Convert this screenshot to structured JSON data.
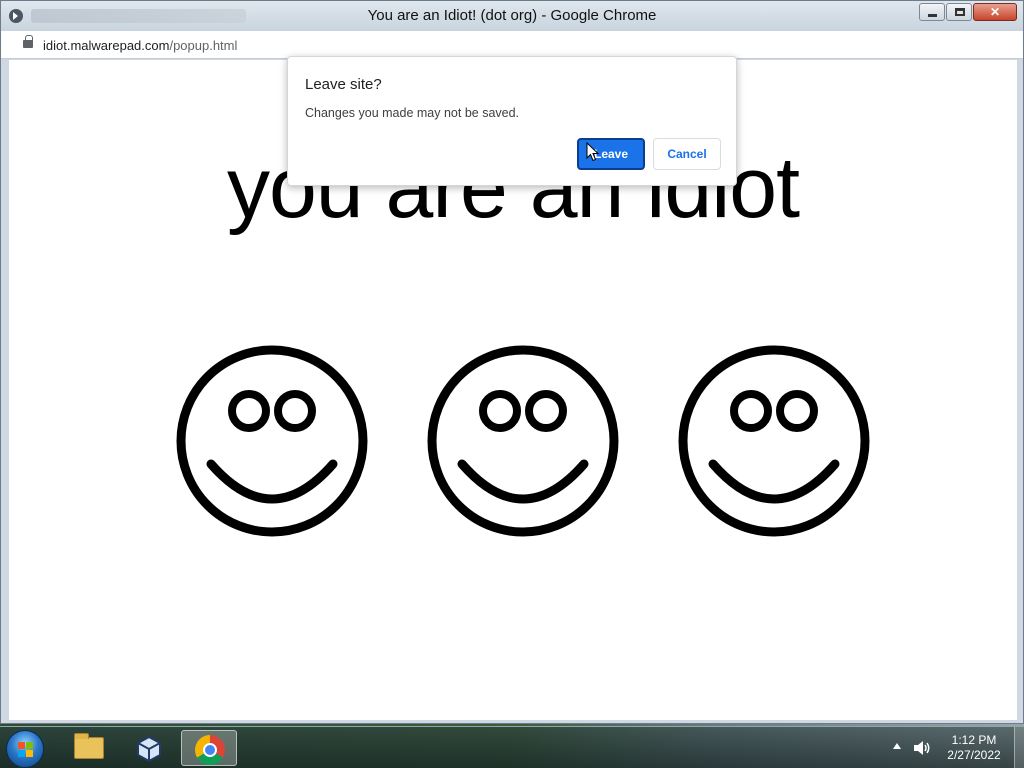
{
  "window": {
    "title": "You are an Idiot! (dot org) - Google Chrome",
    "controls": {
      "minimize": "–",
      "maximize": "□",
      "close": "✕"
    }
  },
  "address": {
    "host": "idiot.malwarepad.com",
    "path": "/popup.html"
  },
  "page": {
    "headline": "you are an idiot",
    "smileys": [
      {
        "icon": "smiley-face-icon"
      },
      {
        "icon": "smiley-face-icon"
      },
      {
        "icon": "smiley-face-icon"
      }
    ]
  },
  "dialog": {
    "title": "Leave site?",
    "message": "Changes you made may not be saved.",
    "leave_label": "Leave",
    "cancel_label": "Cancel"
  },
  "taskbar": {
    "items": [
      {
        "name": "windows-explorer",
        "icon": "folder-icon"
      },
      {
        "name": "virtualbox",
        "icon": "virtualbox-icon"
      },
      {
        "name": "google-chrome",
        "icon": "chrome-icon",
        "active": true
      }
    ],
    "clock": {
      "time": "1:12 PM",
      "date": "2/27/2022"
    }
  },
  "colors": {
    "accent": "#1a73e8",
    "page_background": "#ffffff",
    "text": "#000000"
  }
}
